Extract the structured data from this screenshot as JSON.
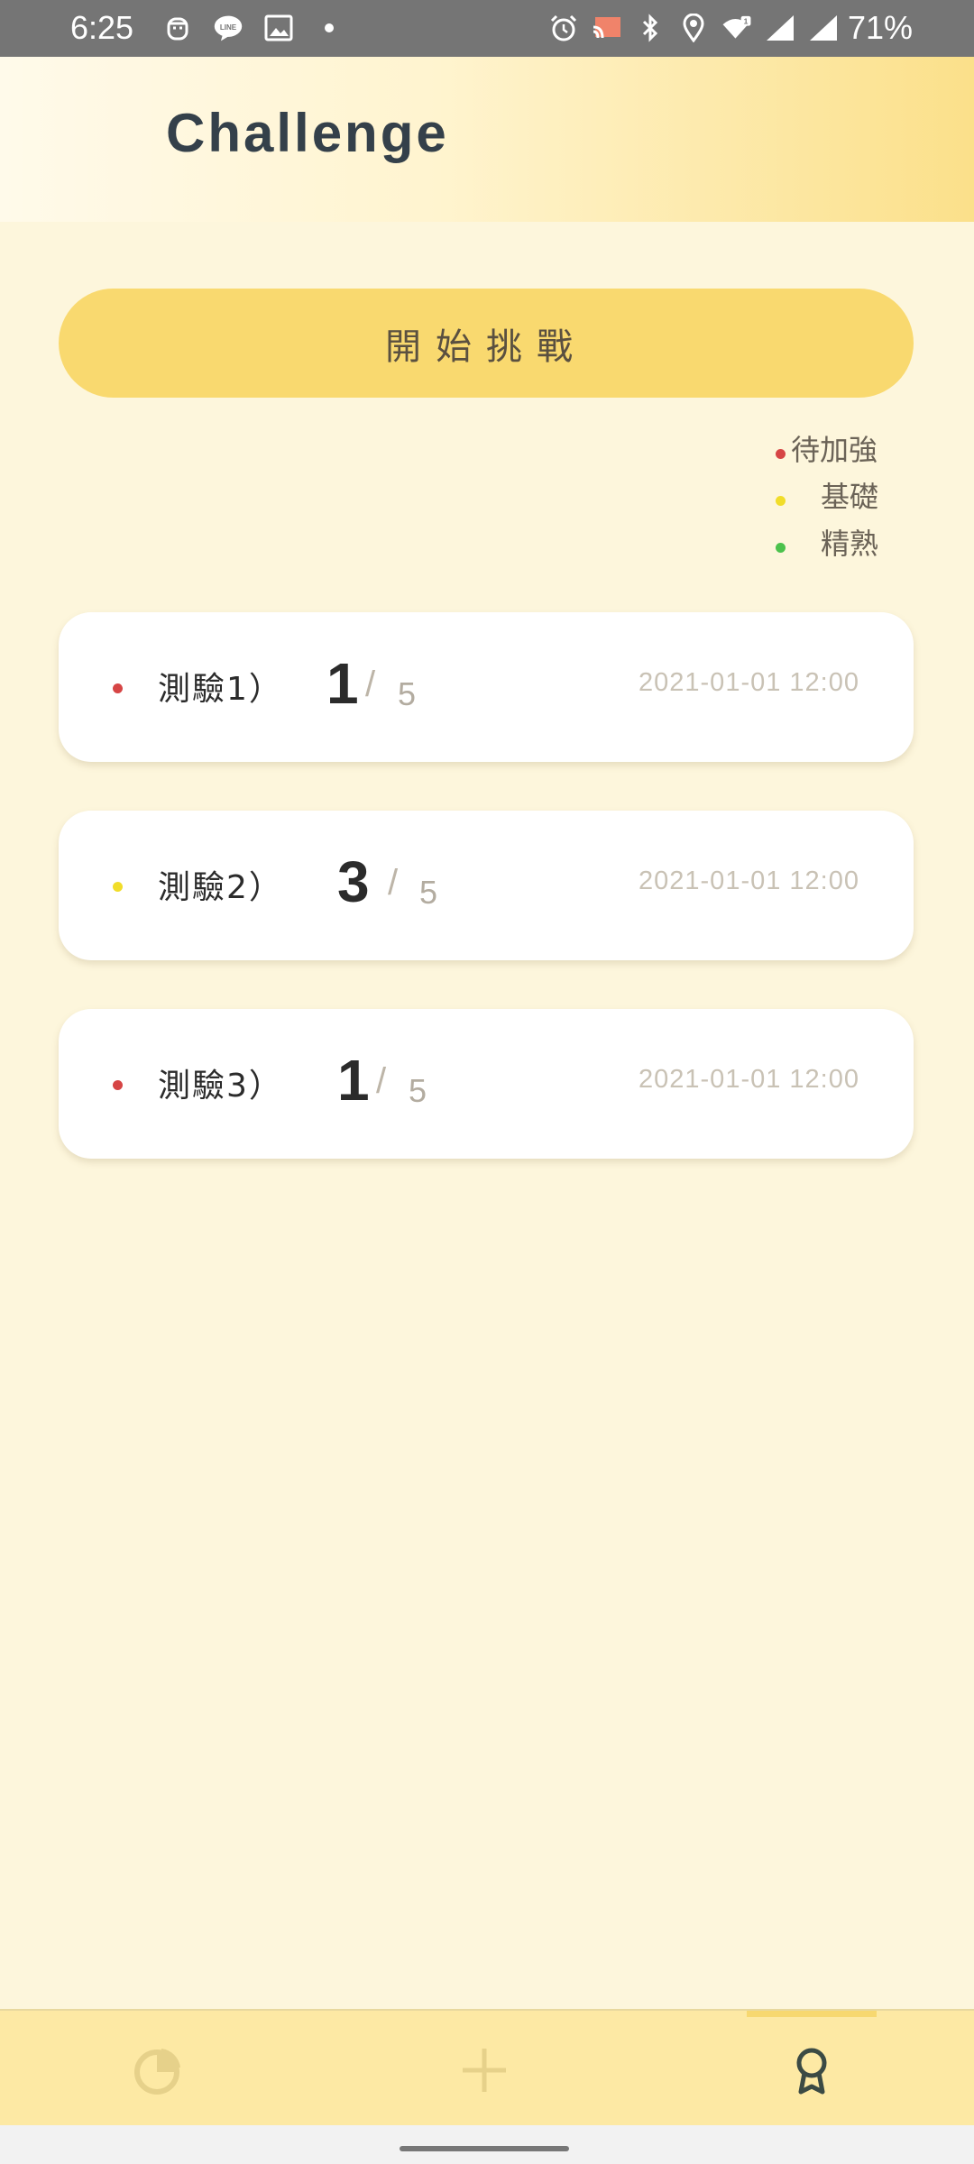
{
  "status_bar": {
    "time": "6:25",
    "battery": "71%",
    "left_icons": [
      "face-icon",
      "line-icon",
      "gallery-icon",
      "dot-icon"
    ],
    "right_icons": [
      "alarm-icon",
      "cast-icon",
      "bluetooth-icon",
      "location-icon",
      "wifi-icon",
      "signal-icon",
      "signal-icon"
    ]
  },
  "header": {
    "title": "Challenge"
  },
  "start_button": {
    "label": "開始挑戰"
  },
  "legend": {
    "items": [
      {
        "label": "待加強",
        "color": "#d64545"
      },
      {
        "label": "基礎",
        "color": "#f1dd2a"
      },
      {
        "label": "精熟",
        "color": "#4cc24c"
      }
    ]
  },
  "quizzes": [
    {
      "name": "測驗1）",
      "score": "1",
      "slash": "/",
      "total": "5",
      "time": "2021-01-01 12:00",
      "dot_color": "#d64545"
    },
    {
      "name": "測驗2）",
      "score": "3",
      "slash": "/",
      "total": "5",
      "time": "2021-01-01 12:00",
      "dot_color": "#f1dd2a"
    },
    {
      "name": "測驗3）",
      "score": "1",
      "slash": "/",
      "total": "5",
      "time": "2021-01-01 12:00",
      "dot_color": "#d64545"
    }
  ],
  "bottom_nav": {
    "items": [
      {
        "icon": "pie-chart-icon",
        "active": false
      },
      {
        "icon": "plus-icon",
        "active": false
      },
      {
        "icon": "badge-icon",
        "active": true
      }
    ],
    "active_color": "#3b4a44",
    "inactive_color": "#e6d18a"
  }
}
